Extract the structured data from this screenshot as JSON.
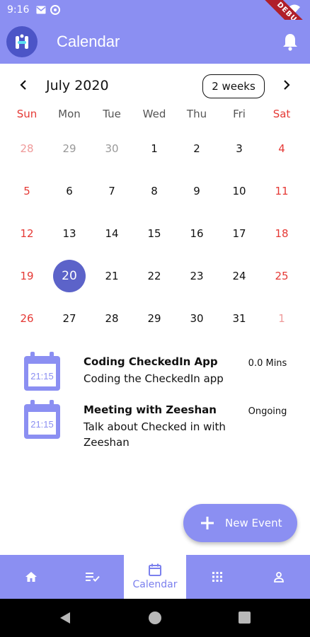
{
  "status_bar": {
    "time": "9:16",
    "debug_badge": "DEBUG"
  },
  "app_bar": {
    "title": "Calendar"
  },
  "calendar": {
    "month_label": "July 2020",
    "format_button": "2 weeks",
    "prev_icon": "‹",
    "next_icon": "›",
    "weekdays": [
      "Sun",
      "Mon",
      "Tue",
      "Wed",
      "Thu",
      "Fri",
      "Sat"
    ],
    "weeks": [
      [
        "28",
        "29",
        "30",
        "1",
        "2",
        "3",
        "4"
      ],
      [
        "5",
        "6",
        "7",
        "8",
        "9",
        "10",
        "11"
      ],
      [
        "12",
        "13",
        "14",
        "15",
        "16",
        "17",
        "18"
      ],
      [
        "19",
        "20",
        "21",
        "22",
        "23",
        "24",
        "25"
      ],
      [
        "26",
        "27",
        "28",
        "29",
        "30",
        "31",
        "1"
      ]
    ],
    "selected_day": "20"
  },
  "events": [
    {
      "icon_time": "21:15",
      "title": "Coding CheckedIn App",
      "description": "Coding the CheckedIn app",
      "status": "0.0 Mins"
    },
    {
      "icon_time": "21:15",
      "title": "Meeting with Zeeshan",
      "description": "Talk about Checked in with Zeeshan",
      "status": "Ongoing"
    }
  ],
  "fab": {
    "label": "New Event"
  },
  "bottom_nav": {
    "active_label": "Calendar"
  },
  "colors": {
    "primary": "#8b8ff2",
    "selected": "#5c63c9",
    "weekend": "#e53935"
  }
}
